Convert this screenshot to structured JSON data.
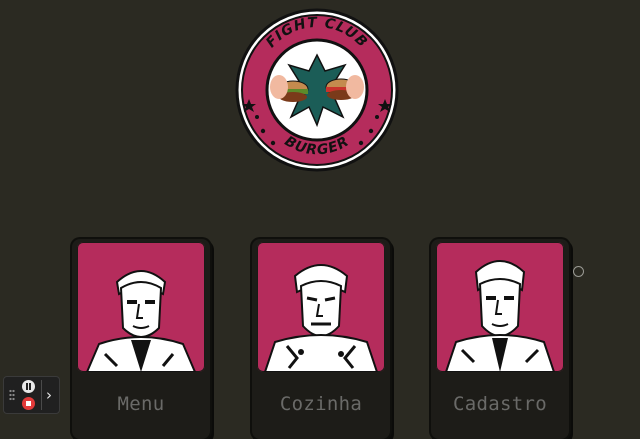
{
  "logo": {
    "top_text": "FIGHT CLUB",
    "bottom_text": "BURGER"
  },
  "cards": [
    {
      "label": "Menu"
    },
    {
      "label": "Cozinha"
    },
    {
      "label": "Cadastro"
    }
  ],
  "colors": {
    "background": "#2b2a22",
    "accent": "#b52c5c",
    "label": "#6a6a68"
  },
  "icons": {
    "player_pause": "pause-icon",
    "player_stop": "stop-icon",
    "player_expand": "chevron-right-icon"
  }
}
